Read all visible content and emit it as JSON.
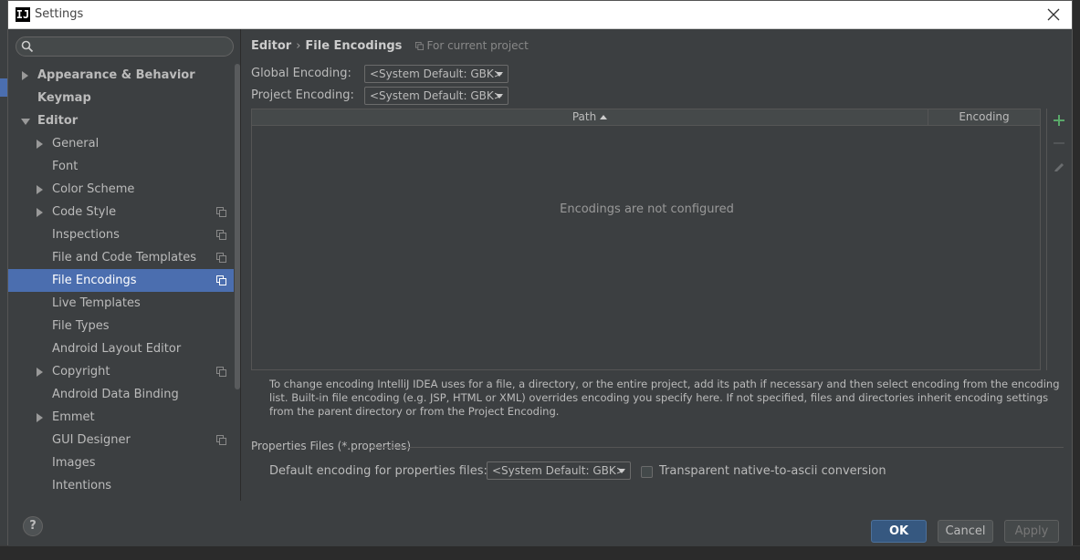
{
  "window": {
    "title": "Settings",
    "app_icon_letter": "IJ"
  },
  "search": {
    "value": "",
    "placeholder": ""
  },
  "sidebar": {
    "items": [
      {
        "label": "Appearance & Behavior"
      },
      {
        "label": "Keymap"
      },
      {
        "label": "Editor"
      },
      {
        "label": "General"
      },
      {
        "label": "Font"
      },
      {
        "label": "Color Scheme"
      },
      {
        "label": "Code Style"
      },
      {
        "label": "Inspections"
      },
      {
        "label": "File and Code Templates"
      },
      {
        "label": "File Encodings"
      },
      {
        "label": "Live Templates"
      },
      {
        "label": "File Types"
      },
      {
        "label": "Android Layout Editor"
      },
      {
        "label": "Copyright"
      },
      {
        "label": "Android Data Binding"
      },
      {
        "label": "Emmet"
      },
      {
        "label": "GUI Designer"
      },
      {
        "label": "Images"
      },
      {
        "label": "Intentions"
      }
    ]
  },
  "breadcrumb": {
    "parent": "Editor",
    "separator": "›",
    "current": "File Encodings",
    "scope": "For current project"
  },
  "global_encoding": {
    "label": "Global Encoding:",
    "value": "<System Default: GBK>"
  },
  "project_encoding": {
    "label": "Project Encoding:",
    "value": "<System Default: GBK>"
  },
  "table": {
    "columns": [
      "Path",
      "Encoding"
    ],
    "empty_message": "Encodings are not configured"
  },
  "help_text": "To change encoding IntelliJ IDEA uses for a file, a directory, or the entire project, add its path if necessary and then select encoding from the encoding list. Built-in file encoding (e.g. JSP, HTML or XML) overrides encoding you specify here. If not specified, files and directories inherit encoding settings from the parent directory or from the Project Encoding.",
  "properties": {
    "section_title": "Properties Files (*.properties)",
    "default_label": "Default encoding for properties files:",
    "default_value": "<System Default: GBK>",
    "transparent_label": "Transparent native-to-ascii conversion",
    "transparent_checked": false
  },
  "footer": {
    "help": "?",
    "ok": "OK",
    "cancel": "Cancel",
    "apply": "Apply"
  },
  "colors": {
    "selected": "#4b6eaf",
    "add": "#59a869",
    "ok_button": "#365880"
  }
}
